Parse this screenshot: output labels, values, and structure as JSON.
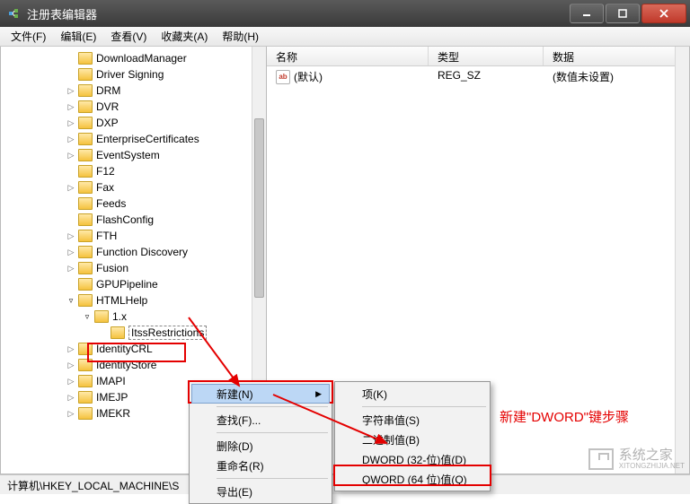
{
  "window": {
    "title": "注册表编辑器"
  },
  "menubar": {
    "file": "文件(F)",
    "edit": "编辑(E)",
    "view": "查看(V)",
    "favorites": "收藏夹(A)",
    "help": "帮助(H)"
  },
  "tree": {
    "items": [
      {
        "label": "DownloadManager",
        "depth": 3,
        "expander": ""
      },
      {
        "label": "Driver Signing",
        "depth": 3,
        "expander": ""
      },
      {
        "label": "DRM",
        "depth": 3,
        "expander": "▷"
      },
      {
        "label": "DVR",
        "depth": 3,
        "expander": "▷"
      },
      {
        "label": "DXP",
        "depth": 3,
        "expander": "▷"
      },
      {
        "label": "EnterpriseCertificates",
        "depth": 3,
        "expander": "▷"
      },
      {
        "label": "EventSystem",
        "depth": 3,
        "expander": "▷"
      },
      {
        "label": "F12",
        "depth": 3,
        "expander": ""
      },
      {
        "label": "Fax",
        "depth": 3,
        "expander": "▷"
      },
      {
        "label": "Feeds",
        "depth": 3,
        "expander": ""
      },
      {
        "label": "FlashConfig",
        "depth": 3,
        "expander": ""
      },
      {
        "label": "FTH",
        "depth": 3,
        "expander": "▷"
      },
      {
        "label": "Function Discovery",
        "depth": 3,
        "expander": "▷"
      },
      {
        "label": "Fusion",
        "depth": 3,
        "expander": "▷"
      },
      {
        "label": "GPUPipeline",
        "depth": 3,
        "expander": ""
      },
      {
        "label": "HTMLHelp",
        "depth": 3,
        "expander": "▿",
        "open": true
      },
      {
        "label": "1.x",
        "depth": 4,
        "expander": "▿",
        "open": true
      },
      {
        "label": "ItssRestrictions",
        "depth": 5,
        "expander": "",
        "selected": true
      },
      {
        "label": "IdentityCRL",
        "depth": 3,
        "expander": "▷"
      },
      {
        "label": "IdentityStore",
        "depth": 3,
        "expander": "▷"
      },
      {
        "label": "IMAPI",
        "depth": 3,
        "expander": "▷"
      },
      {
        "label": "IMEJP",
        "depth": 3,
        "expander": "▷"
      },
      {
        "label": "IMEKR",
        "depth": 3,
        "expander": "▷"
      }
    ]
  },
  "list": {
    "columns": {
      "name": "名称",
      "type": "类型",
      "data": "数据"
    },
    "rows": [
      {
        "name": "(默认)",
        "type": "REG_SZ",
        "data": "(数值未设置)"
      }
    ]
  },
  "context_menu": {
    "new": "新建(N)",
    "find": "查找(F)...",
    "delete": "删除(D)",
    "rename": "重命名(R)",
    "export": "导出(E)"
  },
  "submenu": {
    "key": "项(K)",
    "string": "字符串值(S)",
    "binary": "二进制值(B)",
    "dword": "DWORD (32-位)值(D)",
    "qword": "QWORD (64 位)值(Q)"
  },
  "statusbar": {
    "path": "计算机\\HKEY_LOCAL_MACHINE\\S"
  },
  "annotation": {
    "text": "新建\"DWORD\"键步骤"
  },
  "watermark": {
    "line1": "系统之家",
    "line2": "XITONGZHIJIA.NET"
  }
}
